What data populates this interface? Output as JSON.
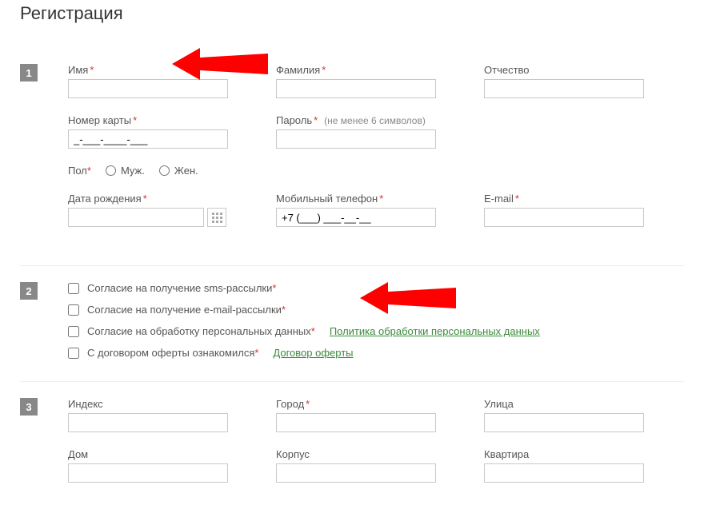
{
  "page": {
    "title": "Регистрация"
  },
  "steps": {
    "one": "1",
    "two": "2",
    "three": "3"
  },
  "fields": {
    "first_name": {
      "label": "Имя"
    },
    "last_name": {
      "label": "Фамилия"
    },
    "middle_name": {
      "label": "Отчество"
    },
    "card_number": {
      "label": "Номер карты",
      "value": "_-___-____-___"
    },
    "password": {
      "label": "Пароль",
      "hint": "(не менее 6 символов)"
    },
    "gender": {
      "label": "Пол",
      "male": "Муж.",
      "female": "Жен."
    },
    "birth_date": {
      "label": "Дата рождения"
    },
    "mobile": {
      "label": "Мобильный телефон",
      "value": "+7 (___) ___-__-__"
    },
    "email": {
      "label": "E-mail"
    },
    "index": {
      "label": "Индекс"
    },
    "city": {
      "label": "Город"
    },
    "street": {
      "label": "Улица"
    },
    "house": {
      "label": "Дом"
    },
    "building": {
      "label": "Корпус"
    },
    "apartment": {
      "label": "Квартира"
    }
  },
  "consents": {
    "sms": "Согласие на получение sms-рассылки",
    "email": "Согласие на получение e-mail-рассылки",
    "personal_data": "Согласие на обработку персональных данных",
    "offer": "С договором оферты ознакомился"
  },
  "links": {
    "privacy_policy": "Политика обработки персональных данных",
    "offer_contract": "Договор оферты"
  },
  "required_marker": "*"
}
